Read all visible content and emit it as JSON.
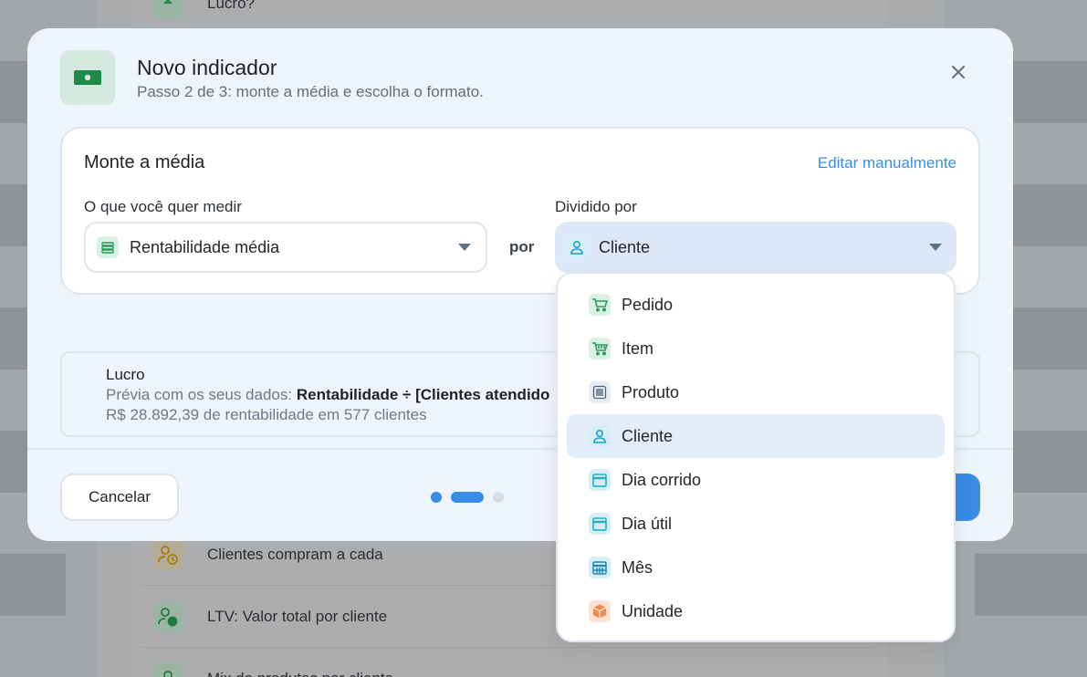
{
  "background": {
    "rows": [
      {
        "label": "Lucro?",
        "icon": "person-up-icon"
      },
      {
        "label": "Clientes compram a cada",
        "icon": "person-clock-icon"
      },
      {
        "label": "LTV: Valor total por cliente",
        "icon": "person-money-icon"
      },
      {
        "label": "Mix de produtos por cliente",
        "icon": "person-icon"
      }
    ]
  },
  "modal": {
    "title": "Novo indicador",
    "subtitle": "Passo 2 de 3: monte a média e escolha o formato.",
    "icon": "money-bill-icon"
  },
  "builder": {
    "title": "Monte a média",
    "edit_link": "Editar manualmente",
    "measure_label": "O que você quer medir",
    "measure_value": "Rentabilidade média",
    "connector": "por",
    "divide_label": "Dividido por",
    "divide_value": "Cliente"
  },
  "preview": {
    "title": "Lucro",
    "line_prefix": "Prévia com os seus dados:",
    "formula": "Rentabilidade ÷ [Clientes atendido",
    "summary": "R$ 28.892,39 de rentabilidade em 577 clientes"
  },
  "footer": {
    "cancel": "Cancelar",
    "step": 2,
    "total_steps": 3
  },
  "dropdown": {
    "selected": "Cliente",
    "options": [
      {
        "label": "Pedido",
        "icon": "cart-icon"
      },
      {
        "label": "Item",
        "icon": "cart-items-icon"
      },
      {
        "label": "Produto",
        "icon": "barcode-icon"
      },
      {
        "label": "Cliente",
        "icon": "person-icon"
      },
      {
        "label": "Dia corrido",
        "icon": "calendar-icon"
      },
      {
        "label": "Dia útil",
        "icon": "calendar-icon"
      },
      {
        "label": "Mês",
        "icon": "calendar-grid-icon"
      },
      {
        "label": "Unidade",
        "icon": "box-icon"
      }
    ]
  },
  "colors": {
    "accent": "#3a8ce6",
    "modal_bg": "#eef4fb",
    "selected_bg": "#dde9f8"
  }
}
